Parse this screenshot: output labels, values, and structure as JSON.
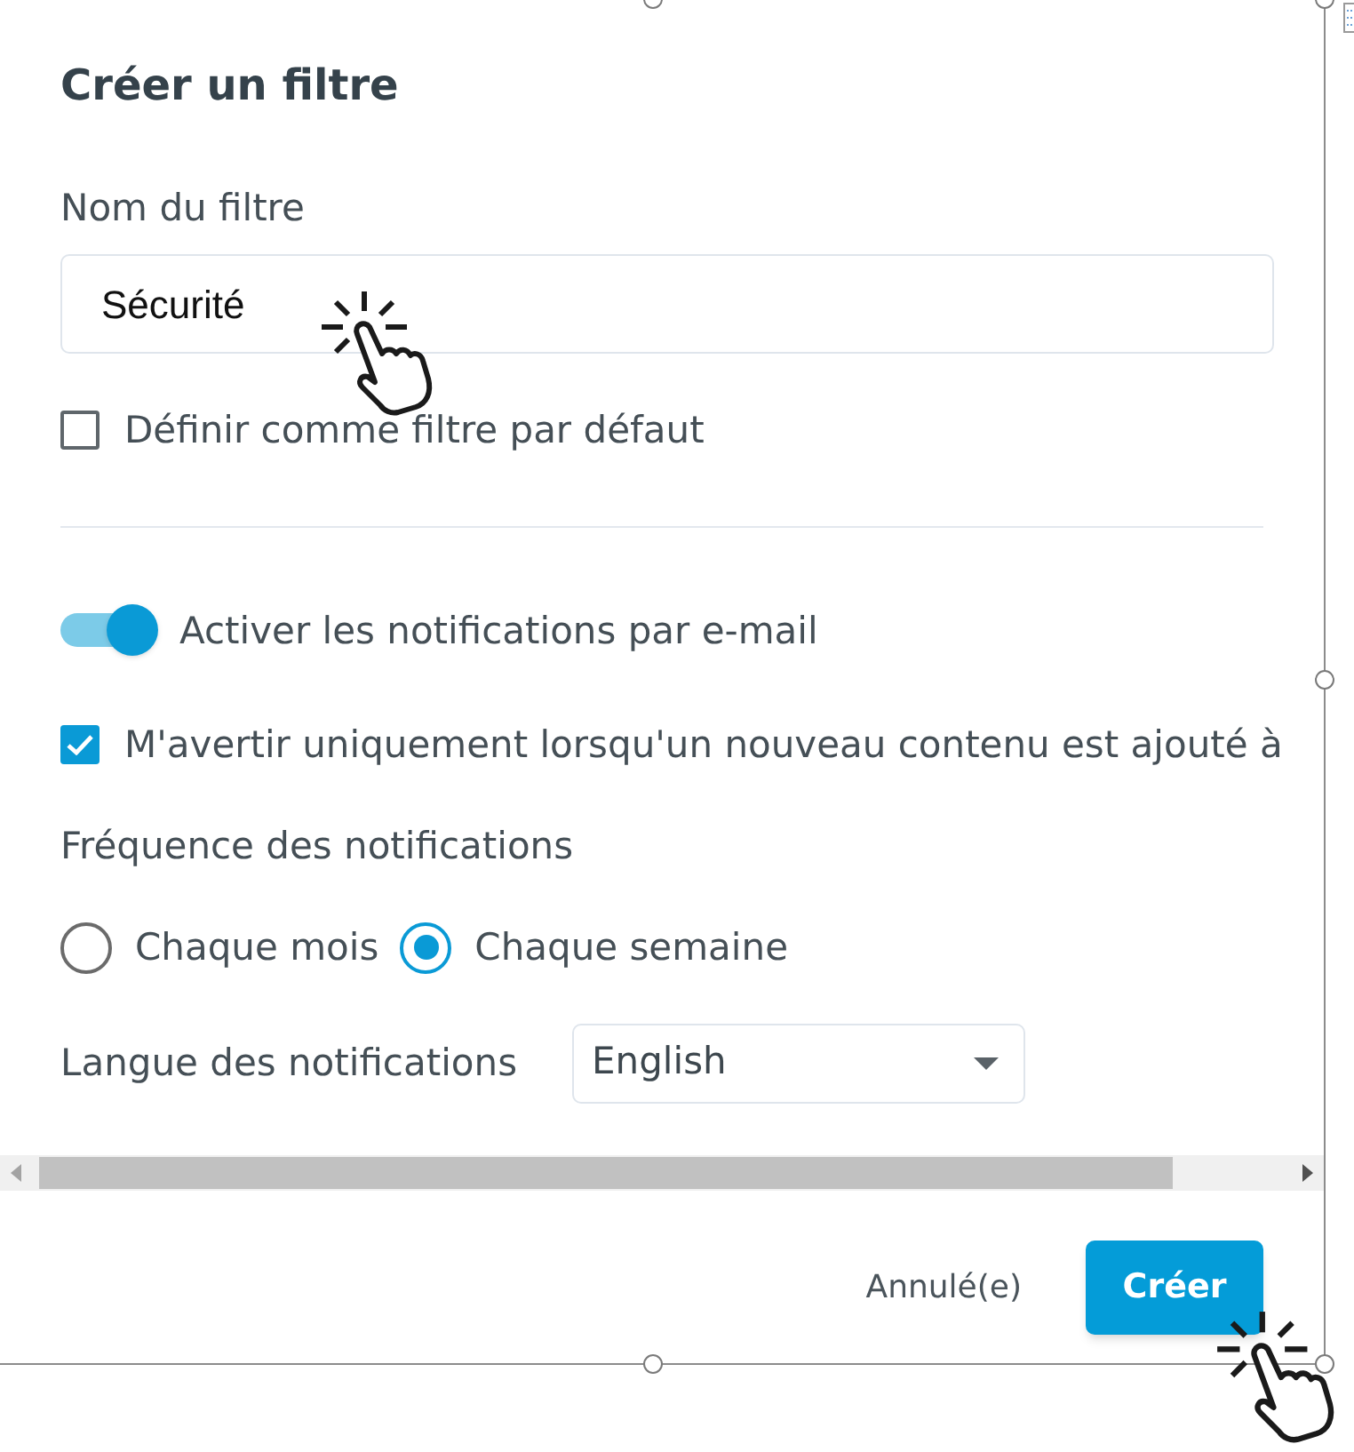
{
  "dialog": {
    "title": "Créer un filtre",
    "name_field": {
      "label": "Nom du filtre",
      "value": "Sécurité"
    },
    "default_checkbox": {
      "label": "Définir comme filtre par défaut",
      "checked": false
    },
    "email_toggle": {
      "label": "Activer les notifications par e-mail",
      "on": true
    },
    "new_content_checkbox": {
      "label": "M'avertir uniquement lorsqu'un nouveau contenu est ajouté à",
      "checked": true
    },
    "frequency": {
      "label": "Fréquence des notifications",
      "options": [
        {
          "label": "Chaque mois",
          "selected": false
        },
        {
          "label": "Chaque semaine",
          "selected": true
        }
      ]
    },
    "language": {
      "label": "Langue des notifications",
      "value": "English"
    },
    "buttons": [
      {
        "label": "Annulé(e)",
        "kind": "text"
      },
      {
        "label": "Créer",
        "kind": "primary"
      }
    ]
  }
}
